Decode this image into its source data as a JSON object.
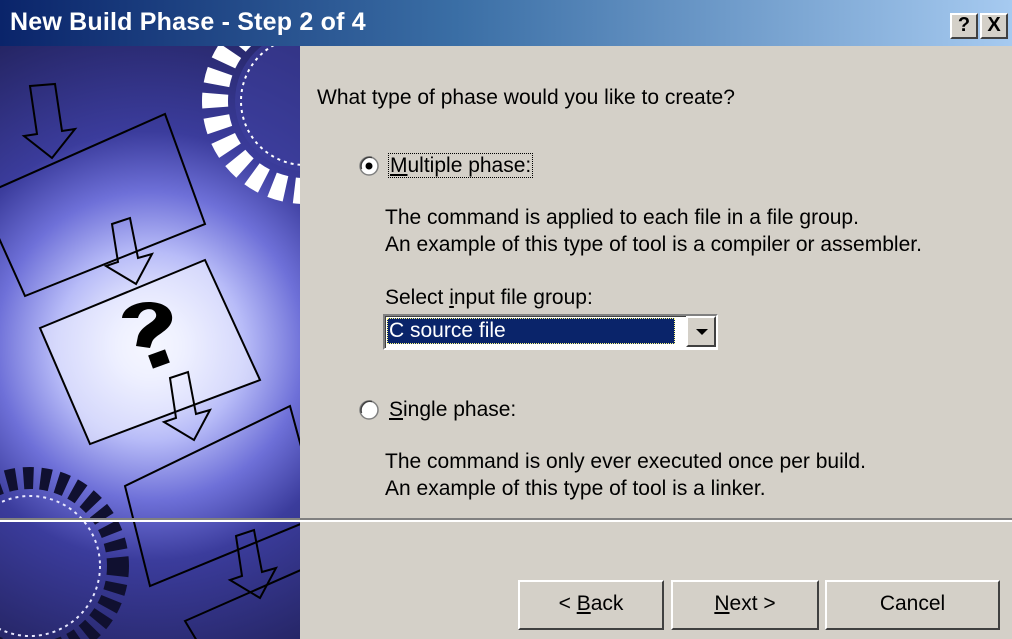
{
  "window": {
    "title": "New Build Phase - Step 2 of 4",
    "help_button": "?",
    "close_button": "X"
  },
  "prompt": "What type of phase would you like to create?",
  "multiple_phase": {
    "label_access": "M",
    "label_rest": "ultiple phase:",
    "selected": true,
    "description_line1": "The command is applied to each file in a file group.",
    "description_line2": "An example of this type of tool is a compiler or assembler.",
    "input_group_label_pre": "Select ",
    "input_group_label_access": "i",
    "input_group_label_post": "nput file group:",
    "input_group_value": "C source file"
  },
  "single_phase": {
    "label_access": "S",
    "label_rest": "ingle phase:",
    "selected": false,
    "description_line1": "The command is only ever executed once per build.",
    "description_line2": "An example of this type of tool is a linker."
  },
  "buttons": {
    "back_pre": "< ",
    "back_access": "B",
    "back_post": "ack",
    "next_access": "N",
    "next_post": "ext >",
    "cancel": "Cancel"
  },
  "colors": {
    "titlebar_start": "#0a246a",
    "titlebar_end": "#a6caf0",
    "dialog_face": "#d4d0c8",
    "selection": "#0a246a"
  },
  "icons": [
    "help-icon",
    "close-icon",
    "radio-selected-icon",
    "radio-unselected-icon",
    "dropdown-arrow-icon",
    "question-mark-icon",
    "gear-icon"
  ]
}
